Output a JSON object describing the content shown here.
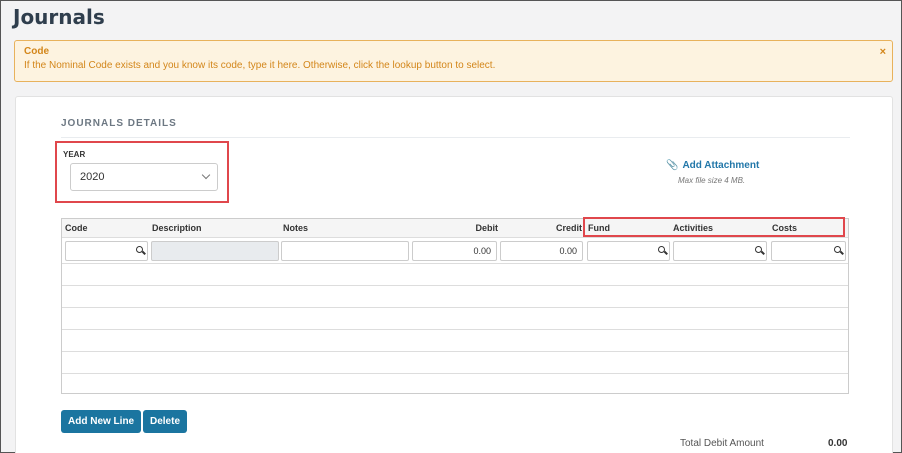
{
  "page": {
    "title": "Journals"
  },
  "alert": {
    "title": "Code",
    "message": "If the Nominal Code exists and you know its code, type it here. Otherwise, click the lookup button to select.",
    "close": "×"
  },
  "details": {
    "section_title": "JOURNALS DETAILS",
    "year_label": "YEAR",
    "year_value": "2020",
    "attachment_label": "Add Attachment",
    "attachment_hint": "Max file size 4 MB."
  },
  "grid": {
    "columns": [
      "Code",
      "Description",
      "Notes",
      "Debit",
      "Credit",
      "Fund",
      "Activities",
      "Costs"
    ],
    "row": {
      "debit": "0.00",
      "credit": "0.00"
    }
  },
  "buttons": {
    "add_line": "Add New Line",
    "delete": "Delete"
  },
  "totals": {
    "debit_label": "Total Debit Amount",
    "debit_value": "0.00"
  },
  "icons": {
    "close": "close-icon",
    "attach": "paperclip-icon",
    "lookup": "search-icon",
    "dropdown": "chevron-down-icon"
  },
  "colors": {
    "accent": "#1b75a0",
    "alert_text": "#d3861a",
    "highlight": "#e0474c"
  }
}
